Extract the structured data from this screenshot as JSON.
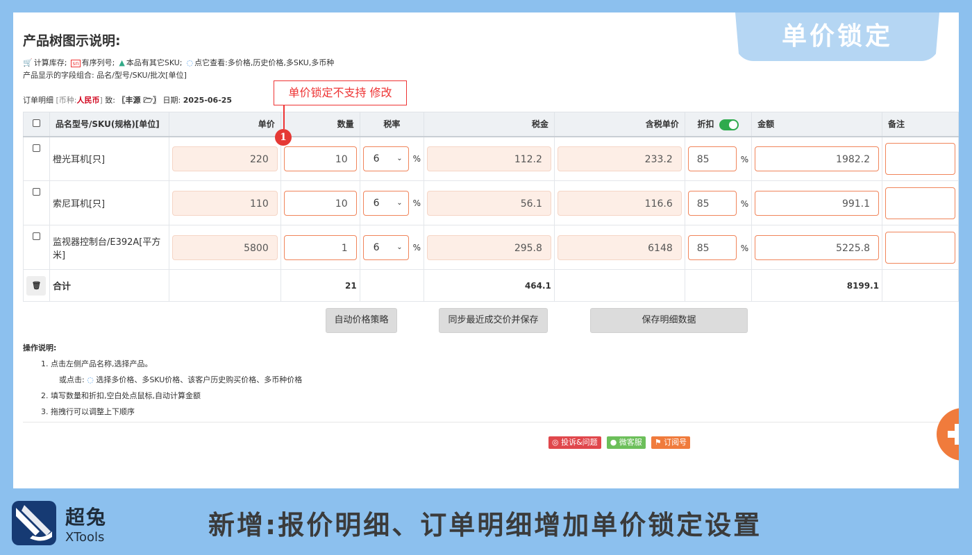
{
  "corner_title": "单价锁定",
  "page_title": "产品树图示说明:",
  "legend": {
    "cart_text": "计算库存;",
    "sn_icon": "sn",
    "sn_text": "有序列号;",
    "sku_text": "本品有其它SKU;",
    "view_text": "点它查看:多价格,历史价格,多SKU,多币种",
    "fields_text": "产品显示的字段组合: 品名/型号/SKU/批次[单位]"
  },
  "order": {
    "label": "订单明细",
    "currency_label": "[币种:",
    "currency": "人民币",
    "currency_close": "]",
    "to_label": "致:",
    "customer": "〖丰源 🗁〗",
    "date_label": "日期:",
    "date": "2025-06-25"
  },
  "callout": {
    "text": "单价锁定不支持 修改",
    "marker": "1"
  },
  "columns": {
    "name": "品名型号/SKU(规格)[单位]",
    "price": "单价",
    "qty": "数量",
    "tax_rate": "税率",
    "tax": "税金",
    "tax_price": "含税单价",
    "discount": "折扣",
    "amount": "金额",
    "note": "备注"
  },
  "rows": [
    {
      "name": "橙光耳机[只]",
      "price": "220",
      "qty": "10",
      "tax_rate": "6",
      "tax": "112.2",
      "tax_price": "233.2",
      "discount": "85",
      "amount": "1982.2"
    },
    {
      "name": "索尼耳机[只]",
      "price": "110",
      "qty": "10",
      "tax_rate": "6",
      "tax": "56.1",
      "tax_price": "116.6",
      "discount": "85",
      "amount": "991.1"
    },
    {
      "name": "监视器控制台/E392A[平方米]",
      "price": "5800",
      "qty": "1",
      "tax_rate": "6",
      "tax": "295.8",
      "tax_price": "6148",
      "discount": "85",
      "amount": "5225.8"
    }
  ],
  "percent_sign": "%",
  "total": {
    "label": "合计",
    "qty": "21",
    "tax": "464.1",
    "amount": "8199.1"
  },
  "buttons": {
    "auto_price": "自动价格策略",
    "sync_price": "同步最近成交价并保存",
    "save_detail": "保存明细数据"
  },
  "ops": {
    "title": "操作说明:",
    "step1": "1. 点击左侧产品名称,选择产品。",
    "step1b_prefix": "或点击:",
    "step1b_text": "选择多价格、多SKU价格、该客户历史购买价格、多币种价格",
    "step2": "2. 填写数量和折扣,空白处点鼠标,自动计算金额",
    "step3": "3. 拖拽行可以调整上下顺序"
  },
  "badges": {
    "complaint": "投诉&问题",
    "wechat": "微客服",
    "subscribe": "订阅号"
  },
  "brand": {
    "cn": "超兔",
    "en": "XTools"
  },
  "footer_title": "新增:报价明细、订单明细增加单价锁定设置",
  "colors": {
    "locked_bg": "#fdeee6",
    "input_border": "#f0845a",
    "toggle_on": "#2faa4d",
    "callout_red": "#e53935",
    "badge_red": "#e0474c",
    "badge_green": "#6cbf5a",
    "badge_orange": "#f07b3c"
  }
}
